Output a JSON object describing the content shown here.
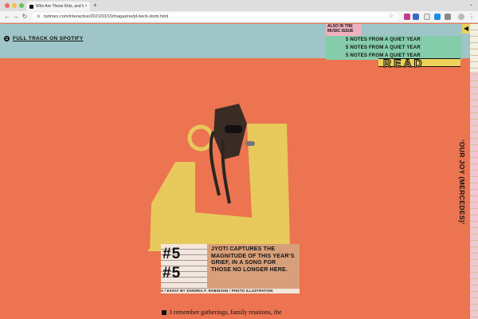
{
  "browser": {
    "tab_title": "Who Are These Kids, and Wh",
    "tab_close": "×",
    "new_tab": "+",
    "url": "nytimes.com/interactive/2021/03/10/magazine/jd-beck-domi.html",
    "back_icon": "arrow-left",
    "forward_icon": "arrow-right",
    "reload_icon": "reload",
    "star_icon": "star"
  },
  "page": {
    "spotify_label": "FULL TRACK ON SPOTIFY",
    "also_label": "ALSO IN THE MUSIC ISSUE",
    "notes": [
      "5 NOTES FROM A QUIET YEAR",
      "5 NOTES FROM A QUIET YEAR",
      "5 NOTES FROM A QUIET YEAR"
    ],
    "read_label": "READ",
    "vertical_title": "‘OUR JOY (MERCEDES)’",
    "number": "#5",
    "number_echo": "#5",
    "blurb": "JYOTI CAPTURES THE MAGNITUDE OF THIS YEAR’S GRIEF, IN A SONG FOR THOSE NO LONGER HERE.",
    "credit": "A / ESSAY BY ZANDRIA F. ROBINSON / PHOTO ILLUSTRATION",
    "body_text": "I remember gatherings, family reunions, the"
  },
  "colors": {
    "background": "#ec7450",
    "top_band": "#9fc5c8",
    "notes_bg": "#85ccab",
    "accent_yellow": "#ecd25a",
    "pink": "#efb0c0"
  }
}
